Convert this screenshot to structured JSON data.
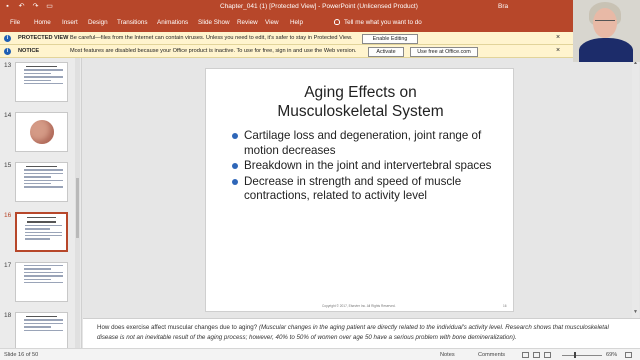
{
  "window": {
    "title": "Chapter_041 (1) [Protected View]  -  PowerPoint (Unlicensed Product)",
    "user": "Bra"
  },
  "ribbon": {
    "tabs": [
      "File",
      "Home",
      "Insert",
      "Design",
      "Transitions",
      "Animations",
      "Slide Show",
      "Review",
      "View",
      "Help"
    ],
    "tell_me": "Tell me what you want to do"
  },
  "protected_view": {
    "label": "PROTECTED VIEW",
    "text": "Be careful—files from the Internet can contain viruses. Unless you need to edit, it's safer to stay in Protected View.",
    "button": "Enable Editing"
  },
  "notice": {
    "label": "NOTICE",
    "text": "Most features are disabled because your Office product is inactive. To use for free, sign in and use the Web version.",
    "activate_button": "Activate",
    "web_button": "Use free at Office.com"
  },
  "thumbnails": [
    "13",
    "14",
    "15",
    "16",
    "17",
    "18"
  ],
  "active_thumbnail": "16",
  "slide": {
    "title_line1": "Aging Effects on",
    "title_line2": "Musculoskeletal System",
    "bullets": [
      "Cartilage loss and degeneration, joint range of motion decreases",
      "Breakdown in the joint and intervertebral spaces",
      "Decrease in strength and speed of muscle contractions, related to activity level"
    ],
    "footer": "Copyright © 2017, Elsevier Inc. All Rights Reserved.",
    "page": "16"
  },
  "notes": {
    "question": "How does exercise affect muscular changes due to aging? ",
    "answer": "(Muscular changes in the aging patient are directly related to the individual's activity level. Research shows that musculoskeletal disease is not an inevitable result of the aging process; however, 40% to 50% of women over age 50 have a serious problem with bone demineralization)."
  },
  "status": {
    "slide_indicator": "Slide 16 of 50",
    "notes_label": "Notes",
    "comments_label": "Comments",
    "zoom": "69%"
  },
  "icons": {
    "info": "info-icon",
    "close": "close-icon",
    "save": "save-icon",
    "undo": "undo-icon",
    "lightbulb": "lightbulb-icon"
  }
}
